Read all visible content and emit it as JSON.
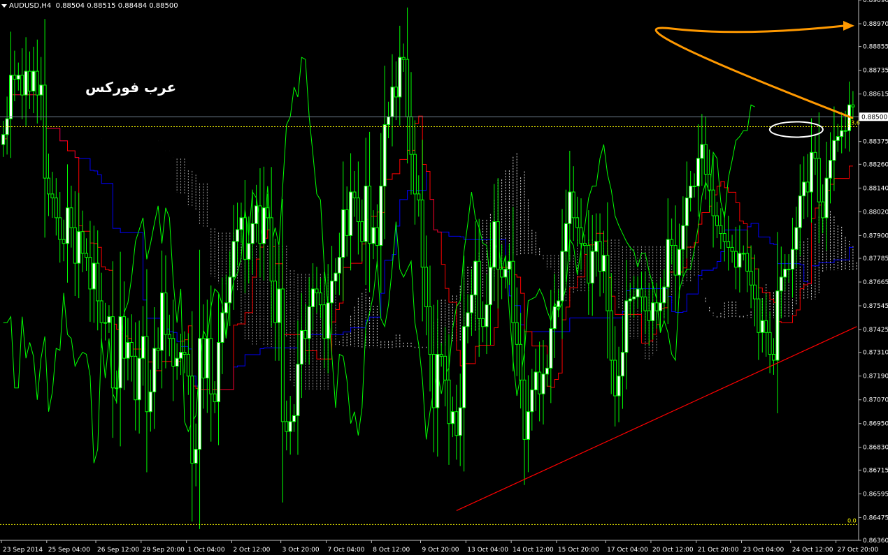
{
  "header": {
    "symbol_timeframe": "AUDUSD,H4",
    "ohlc": "0.88504 0.88515 0.88484 0.88500"
  },
  "watermark_text": "عرب فوركس",
  "colors": {
    "background": "#000000",
    "grid": "#3a3a3a",
    "bull_candle": "#ffffff",
    "candle_outline": "#00ff00",
    "tenkan": "#ff0000",
    "kijun": "#0000ff",
    "chikou": "#00ff00",
    "cloud": "#ffffff",
    "fib_line": "#ffff00",
    "trend_line": "#ff0000",
    "arrow": "#ff9900",
    "price_line": "#708090"
  },
  "chart_data": {
    "type": "candlestick",
    "ylim": [
      0.8636,
      0.8909
    ],
    "price_ticks": [
      "0.89090",
      "0.88970",
      "0.88855",
      "0.88735",
      "0.88615",
      "0.88500",
      "0.88375",
      "0.88260",
      "0.88140",
      "0.88020",
      "0.87900",
      "0.87785",
      "0.87665",
      "0.87545",
      "0.87425",
      "0.87310",
      "0.87190",
      "0.87070",
      "0.86950",
      "0.86830",
      "0.86715",
      "0.86595",
      "0.86475",
      "0.86360"
    ],
    "current_price": "0.88500",
    "time_ticks": [
      "23 Sep 2014",
      "25 Sep 04:00",
      "26 Sep 12:00",
      "29 Sep 20:00",
      "1 Oct 04:00",
      "2 Oct 12:00",
      "3 Oct 20:00",
      "7 Oct 04:00",
      "8 Oct 12:00",
      "9 Oct 20:00",
      "13 Oct 04:00",
      "14 Oct 12:00",
      "15 Oct 20:00",
      "17 Oct 04:00",
      "20 Oct 12:00",
      "21 Oct 20:00",
      "23 Oct 04:00",
      "24 Oct 12:00",
      "27 Oct 20:00"
    ],
    "fib_labels": [
      "23.6",
      "0.0"
    ],
    "fib_levels": [
      0.8845,
      0.8644
    ],
    "trendline": {
      "from_bar": 120,
      "to_bar": 226,
      "from_price": 0.8651,
      "to_price": 0.8744
    },
    "close": [
      0.8841,
      0.8849,
      0.8871,
      0.8869,
      0.8871,
      0.8861,
      0.8873,
      0.8863,
      0.8873,
      0.8861,
      0.8866,
      0.8819,
      0.8811,
      0.8809,
      0.8799,
      0.8788,
      0.8786,
      0.8804,
      0.8794,
      0.8776,
      0.8792,
      0.8781,
      0.8779,
      0.8763,
      0.8776,
      0.8757,
      0.8746,
      0.8746,
      0.8749,
      0.8713,
      0.8713,
      0.8749,
      0.8728,
      0.8736,
      0.8729,
      0.8707,
      0.8728,
      0.8739,
      0.8701,
      0.8711,
      0.8733,
      0.8732,
      0.8761,
      0.874,
      0.8738,
      0.8724,
      0.8728,
      0.8731,
      0.873,
      0.8719,
      0.8675,
      0.8682,
      0.8738,
      0.8718,
      0.8738,
      0.871,
      0.8706,
      0.8736,
      0.8751,
      0.8756,
      0.8769,
      0.8787,
      0.8793,
      0.8799,
      0.8778,
      0.8786,
      0.8796,
      0.8805,
      0.8786,
      0.8804,
      0.8799,
      0.8767,
      0.8746,
      0.8763,
      0.8696,
      0.8691,
      0.8696,
      0.8699,
      0.8725,
      0.8742,
      0.8738,
      0.8754,
      0.8763,
      0.8761,
      0.8755,
      0.8738,
      0.8756,
      0.8767,
      0.8771,
      0.8779,
      0.8803,
      0.879,
      0.8812,
      0.8809,
      0.8797,
      0.8787,
      0.8815,
      0.8786,
      0.8794,
      0.8785,
      0.8815,
      0.8846,
      0.885,
      0.8865,
      0.886,
      0.888,
      0.8879,
      0.885,
      0.8831,
      0.8811,
      0.8808,
      0.8774,
      0.8754,
      0.873,
      0.8703,
      0.873,
      0.8729,
      0.8717,
      0.8695,
      0.8701,
      0.8689,
      0.8703,
      0.8744,
      0.8751,
      0.876,
      0.8777,
      0.8748,
      0.8744,
      0.8755,
      0.8774,
      0.8797,
      0.8773,
      0.8769,
      0.8773,
      0.8777,
      0.8746,
      0.8735,
      0.8717,
      0.8687,
      0.8701,
      0.8712,
      0.8721,
      0.871,
      0.872,
      0.8723,
      0.8743,
      0.8754,
      0.8757,
      0.8782,
      0.8796,
      0.8812,
      0.8799,
      0.8794,
      0.8786,
      0.8785,
      0.8766,
      0.8782,
      0.8787,
      0.8772,
      0.878,
      0.8752,
      0.8727,
      0.8709,
      0.8719,
      0.8731,
      0.8757,
      0.8758,
      0.8759,
      0.8763,
      0.8759,
      0.8752,
      0.8747,
      0.8756,
      0.8752,
      0.8756,
      0.8764,
      0.8788,
      0.8785,
      0.877,
      0.8783,
      0.8795,
      0.8809,
      0.8815,
      0.8815,
      0.8829,
      0.8836,
      0.8821,
      0.8813,
      0.88,
      0.8795,
      0.8791,
      0.8787,
      0.8784,
      0.8782,
      0.8774,
      0.8781,
      0.8781,
      0.8772,
      0.8765,
      0.8758,
      0.8741,
      0.8747,
      0.8741,
      0.873,
      0.8727,
      0.8762,
      0.8769,
      0.8773,
      0.8773,
      0.8783,
      0.8794,
      0.881,
      0.8817,
      0.8812,
      0.8832,
      0.8829,
      0.8807,
      0.8799,
      0.8819,
      0.8828,
      0.8838,
      0.884,
      0.8843,
      0.8843,
      0.8856,
      0.8855
    ],
    "bars": 227,
    "title": "AUDUSD,H4"
  }
}
